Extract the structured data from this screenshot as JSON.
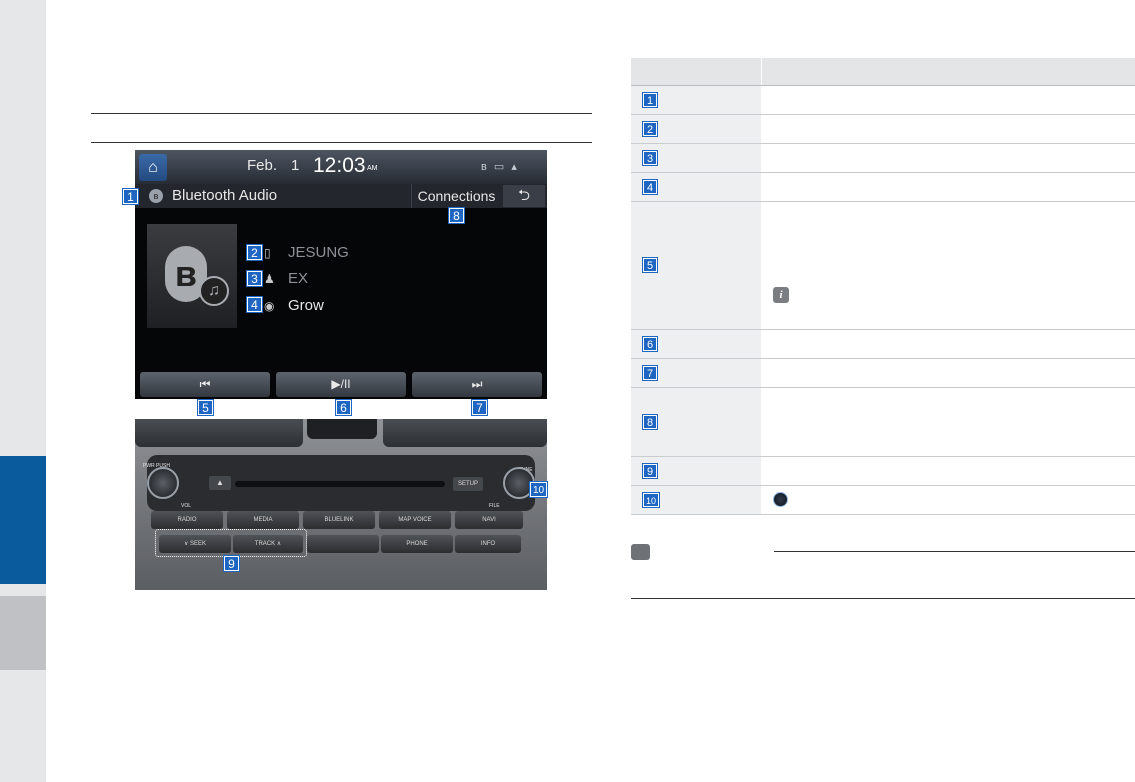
{
  "screen": {
    "date": "Feb.",
    "day": "1",
    "time": "12:03",
    "ampm": "AM",
    "title": "Bluetooth Audio",
    "connections_label": "Connections",
    "back_label": "⮌",
    "device_name": "JESUNG",
    "artist": "EX",
    "album": "Grow",
    "prev_label": "⏮",
    "play_pause_label": "▶/II",
    "next_label": "⏭"
  },
  "console": {
    "vol_label": "VOL",
    "tune_label": "TUNE",
    "file_label": "FILE",
    "pwr_label": "PWR PUSH",
    "setup_label": "SETUP",
    "buttons_row1": [
      "RADIO",
      "MEDIA",
      "BLUELINK",
      "MAP VOICE",
      "NAVI"
    ],
    "buttons_row2": [
      "∨ SEEK",
      "TRACK ∧",
      "",
      "PHONE",
      "INFO"
    ]
  },
  "badges": [
    "1",
    "2",
    "3",
    "4",
    "5",
    "6",
    "7",
    "8",
    "9",
    "10"
  ],
  "table": {
    "rows": [
      "1",
      "2",
      "3",
      "4",
      "5",
      "6",
      "7",
      "8",
      "9",
      "10"
    ],
    "info_icon": "i"
  },
  "colors": {
    "accent_blue": "#1f66c2",
    "side_tab_active": "#0a5b9e",
    "screen_bg": "#050608"
  }
}
